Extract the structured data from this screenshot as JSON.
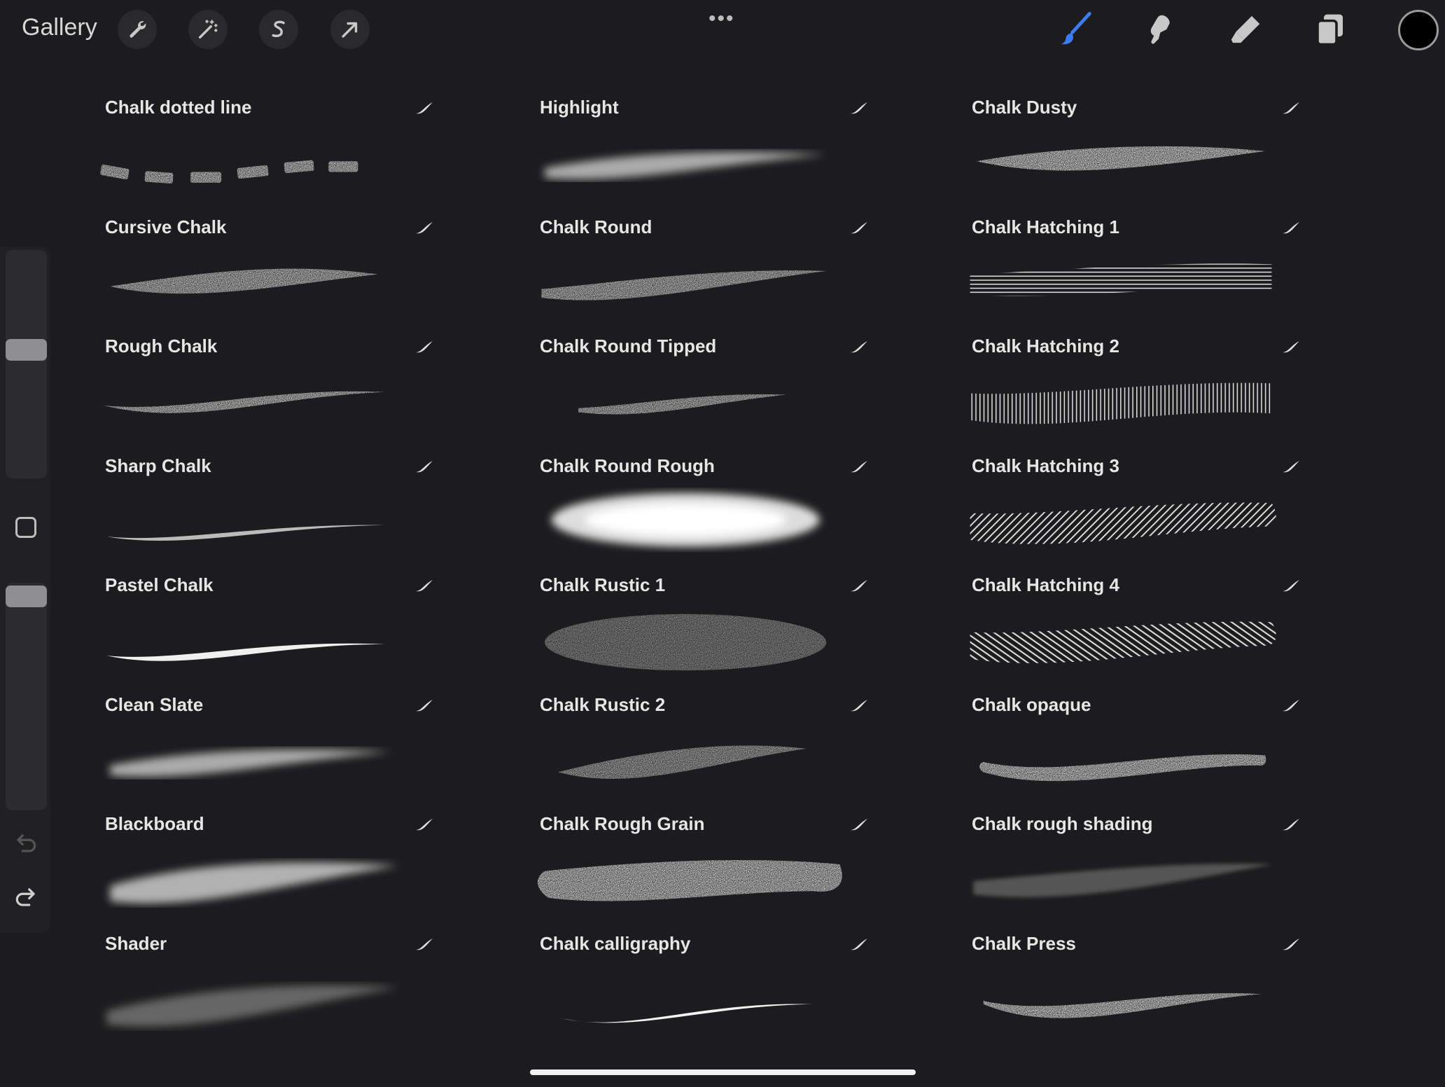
{
  "topbar": {
    "gallery_label": "Gallery",
    "left_tools": [
      {
        "name": "wrench-icon"
      },
      {
        "name": "magic-wand-icon"
      },
      {
        "name": "selection-s-icon"
      },
      {
        "name": "arrow-cursor-icon"
      }
    ],
    "more_label": "•••",
    "right_tools": [
      {
        "name": "brush-icon",
        "active": true,
        "color": "#3b7bf0"
      },
      {
        "name": "smudge-icon"
      },
      {
        "name": "eraser-icon"
      },
      {
        "name": "layers-icon"
      }
    ],
    "current_color": "#000000"
  },
  "sidebar": {
    "size_slider_value": 0.55,
    "opacity_slider_value": 1.0
  },
  "brush_columns": [
    {
      "brushes": [
        {
          "name": "Chalk  dotted line",
          "style": "dotted"
        },
        {
          "name": "Cursive Chalk",
          "style": "cursive"
        },
        {
          "name": "Rough Chalk",
          "style": "rough"
        },
        {
          "name": "Sharp Chalk",
          "style": "sharp"
        },
        {
          "name": "Pastel Chalk",
          "style": "pastel"
        },
        {
          "name": "Clean Slate",
          "style": "soft"
        },
        {
          "name": "Blackboard",
          "style": "soft-wide"
        },
        {
          "name": "Shader",
          "style": "shader"
        }
      ]
    },
    {
      "brushes": [
        {
          "name": "Highlight",
          "style": "soft"
        },
        {
          "name": "Chalk Round",
          "style": "grainy"
        },
        {
          "name": "Chalk Round Tipped",
          "style": "grainy-thin"
        },
        {
          "name": "Chalk Round Rough",
          "style": "cloud"
        },
        {
          "name": "Chalk Rustic 1",
          "style": "rustic"
        },
        {
          "name": "Chalk Rustic 2",
          "style": "rustic-thin"
        },
        {
          "name": "Chalk Rough Grain",
          "style": "rough-grain"
        },
        {
          "name": "Chalk calligraphy",
          "style": "calligraphy"
        }
      ]
    },
    {
      "brushes": [
        {
          "name": "Chalk Dusty",
          "style": "dusty"
        },
        {
          "name": "Chalk Hatching 1",
          "style": "hatch-h"
        },
        {
          "name": "Chalk Hatching 2",
          "style": "hatch-v"
        },
        {
          "name": "Chalk Hatching 3",
          "style": "hatch-d"
        },
        {
          "name": "Chalk Hatching 4",
          "style": "hatch-d2"
        },
        {
          "name": "Chalk opaque",
          "style": "opaque"
        },
        {
          "name": "Chalk rough shading",
          "style": "shading"
        },
        {
          "name": "Chalk Press",
          "style": "press"
        }
      ]
    }
  ]
}
